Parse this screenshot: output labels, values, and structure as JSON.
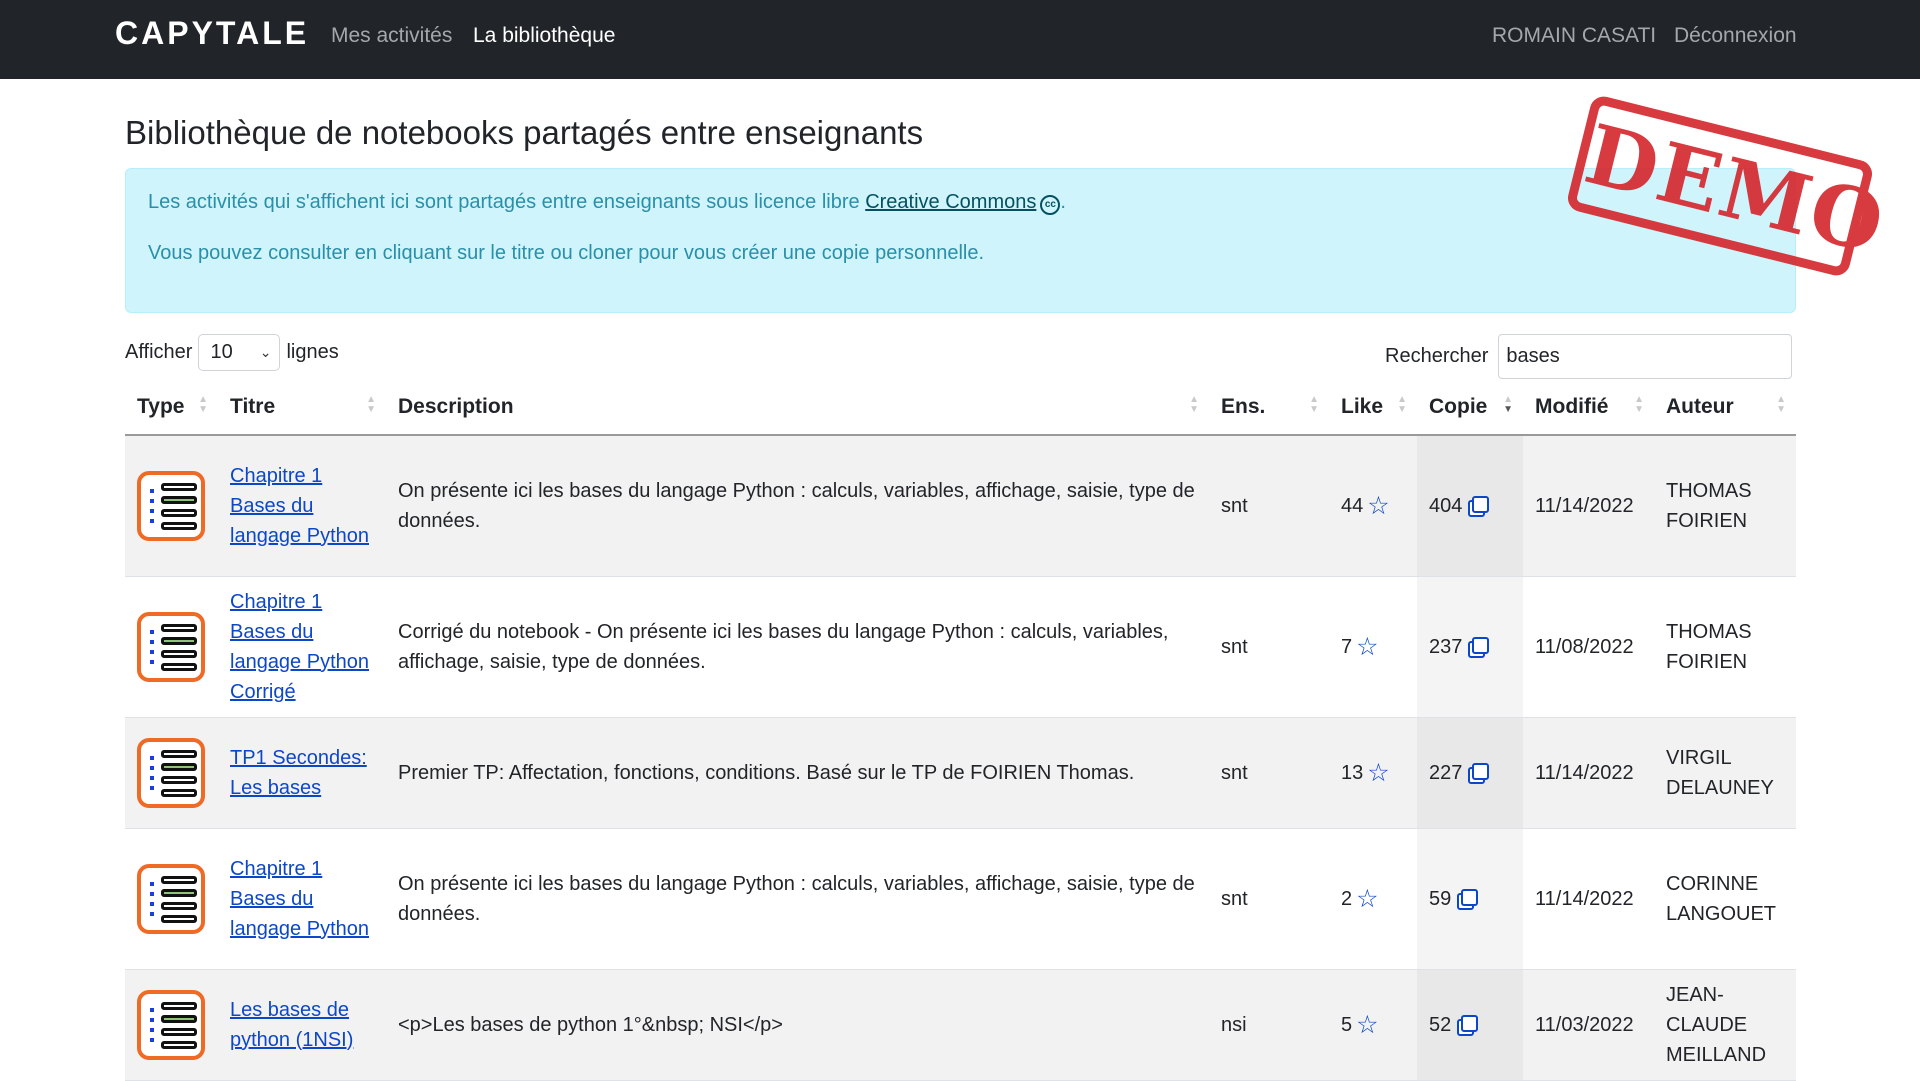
{
  "navbar": {
    "brand": "CAPYTALE",
    "links": [
      "Mes activités",
      "La bibliothèque"
    ],
    "user": "ROMAIN CASATI",
    "logout": "Déconnexion"
  },
  "page": {
    "title": "Bibliothèque de notebooks partagés entre enseignants",
    "stamp": "DEMO"
  },
  "alert": {
    "line1_prefix": "Les activités qui s'affichent ici sont partagés entre enseignants sous licence libre",
    "link": "Creative Commons",
    "cc_icon_text": "cc",
    "line1_suffix": ".",
    "line2": "Vous pouvez consulter en cliquant sur le titre ou cloner pour vous créer une copie personnelle."
  },
  "controls": {
    "show_label": "Afficher",
    "page_size": "10",
    "rows_label": "lignes",
    "search_label": "Rechercher",
    "search_value": "bases"
  },
  "table": {
    "headers": [
      "Type",
      "Titre",
      "Description",
      "Ens.",
      "Like",
      "Copie",
      "Modifié",
      "Auteur"
    ],
    "rows": [
      {
        "title": "Chapitre 1 Bases du langage Python",
        "description": "On présente ici les bases du langage Python : calculs, variables, affichage, saisie, type de données.",
        "ens": "snt",
        "like": "44",
        "copie": "404",
        "modifie": "11/14/2022",
        "auteur": "THOMAS FOIRIEN"
      },
      {
        "title": "Chapitre 1 Bases du langage Python Corrigé",
        "description": "Corrigé du notebook - On présente ici les bases du langage Python : calculs, variables, affichage, saisie, type de données.",
        "ens": "snt",
        "like": "7",
        "copie": "237",
        "modifie": "11/08/2022",
        "auteur": "THOMAS FOIRIEN"
      },
      {
        "title": "TP1 Secondes: Les bases",
        "description": "Premier TP: Affectation, fonctions, conditions. Basé sur le TP de FOIRIEN Thomas.",
        "ens": "snt",
        "like": "13",
        "copie": "227",
        "modifie": "11/14/2022",
        "auteur": "VIRGIL DELAUNEY"
      },
      {
        "title": "Chapitre 1 Bases du langage Python",
        "description": "On présente ici les bases du langage Python : calculs, variables, affichage, saisie, type de données.",
        "ens": "snt",
        "like": "2",
        "copie": "59",
        "modifie": "11/14/2022",
        "auteur": "CORINNE LANGOUET"
      },
      {
        "title": "Les bases de python (1NSI)",
        "description": "<p>Les bases de python 1°&nbsp; NSI</p>",
        "ens": "nsi",
        "like": "5",
        "copie": "52",
        "modifie": "11/03/2022",
        "auteur": "JEAN-CLAUDE MEILLAND"
      }
    ]
  },
  "icons": {
    "type": "notebook-icon",
    "like": "star-icon",
    "copy": "copy-icon",
    "sort": "sort-arrows-icon"
  },
  "colors": {
    "navbar": "#212529",
    "alert_bg": "#cff4fc",
    "alert_text": "#2a8fa8",
    "link": "#0d47c9",
    "stamp": "#d42a2f",
    "notebook_border": "#ef6a25"
  }
}
